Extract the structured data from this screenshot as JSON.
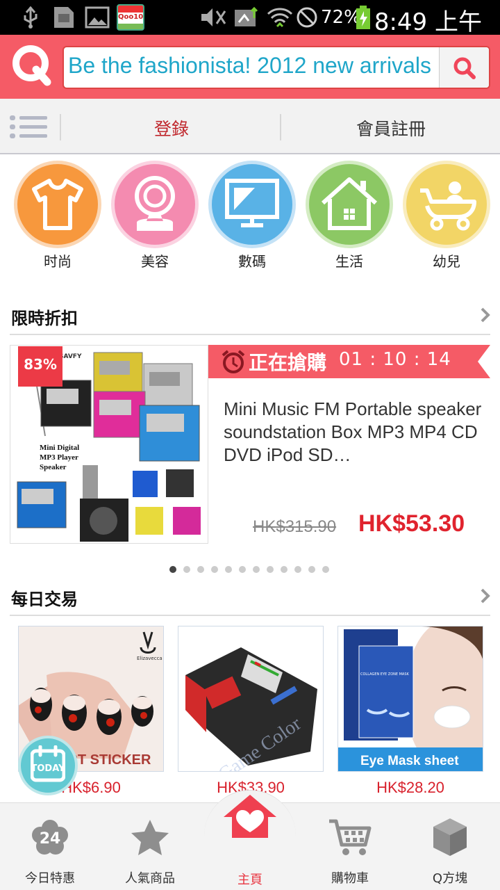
{
  "status_bar": {
    "battery": "72%",
    "time": "8:49 上午",
    "icons": [
      "usb-icon",
      "sd-card-icon",
      "image-icon",
      "qoo10-app-icon",
      "mute-icon",
      "data-icon",
      "wifi-icon",
      "blocked-icon",
      "battery-charging-icon"
    ],
    "app_icon_text": "Qoo10"
  },
  "header": {
    "logo_icon": "qoo10-q-logo",
    "search_text": "Be the fashionista! 2012 new arrivals",
    "search_icon": "search-icon",
    "accent": "#f55b66"
  },
  "login_bar": {
    "menu_icon": "list-menu-icon",
    "login": "登錄",
    "register": "會員註冊"
  },
  "categories": [
    {
      "label": "时尚",
      "icon": "tshirt-icon",
      "color": "#f7983d"
    },
    {
      "label": "美容",
      "icon": "mirror-icon",
      "color": "#f48bb0"
    },
    {
      "label": "數碼",
      "icon": "monitor-icon",
      "color": "#59b2e6"
    },
    {
      "label": "生活",
      "icon": "house-icon",
      "color": "#8cc864"
    },
    {
      "label": "幼兒",
      "icon": "stroller-icon",
      "color": "#f2d566"
    }
  ],
  "flash_sale": {
    "title": "限時折扣",
    "discount": "83%",
    "banner_label": "正在搶購",
    "timer": "01 : 10 : 14",
    "product_title": "Mini Music FM Portable speaker soundstation Box MP3 MP4 CD DVD iPod SD…",
    "old_price": "HK$315.90",
    "new_price": "HK$53.30",
    "image_text": {
      "line1": "Mini Digital",
      "line2": "MP3 Player",
      "line3": "Speaker",
      "brand": "SAVFY"
    },
    "page_count": 12,
    "active_page": 1
  },
  "daily_deals": {
    "title": "每日交易",
    "today_badge": "TODAY",
    "items": [
      {
        "price": "HK$6.90",
        "image": "nail-sticker-image",
        "caption": "ART STICKER",
        "brand": "Elizavecca"
      },
      {
        "price": "HK$33.90",
        "image": "battery-tester-image",
        "caption": "Game Color"
      },
      {
        "price": "HK$28.20",
        "image": "eye-mask-image",
        "caption": "Eye Mask sheet",
        "pack_text": "COLLAGEN EYE ZONE MASK"
      }
    ]
  },
  "bottom_nav": [
    {
      "label": "今日特惠",
      "icon": "flower-24-icon",
      "badge": "24",
      "active": false
    },
    {
      "label": "人氣商品",
      "icon": "star-icon",
      "active": false
    },
    {
      "label": "主頁",
      "icon": "home-heart-icon",
      "active": true
    },
    {
      "label": "購物車",
      "icon": "cart-icon",
      "active": false
    },
    {
      "label": "Q方塊",
      "icon": "cube-icon",
      "active": false
    }
  ]
}
